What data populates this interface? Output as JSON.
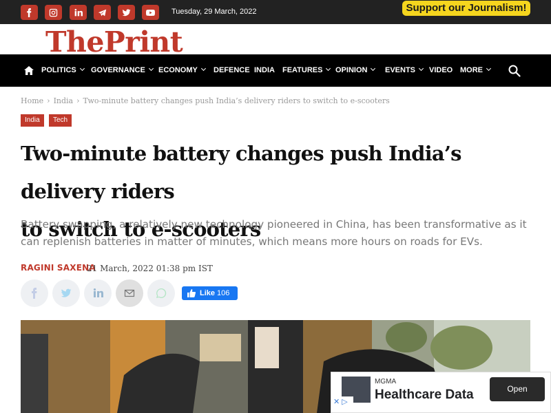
{
  "topbar": {
    "date": "Tuesday, 29 March, 2022",
    "support_label": "Support our Journalism!",
    "social_icons": [
      "facebook-icon",
      "instagram-icon",
      "linkedin-icon",
      "telegram-icon",
      "twitter-icon",
      "youtube-icon"
    ]
  },
  "logo": {
    "text": "ThePrint"
  },
  "nav": {
    "items": [
      {
        "label": "POLITICS",
        "dropdown": true
      },
      {
        "label": "GOVERNANCE",
        "dropdown": true
      },
      {
        "label": "ECONOMY",
        "dropdown": true
      },
      {
        "label": "DEFENCE",
        "dropdown": false
      },
      {
        "label": "INDIA",
        "dropdown": false
      },
      {
        "label": "FEATURES",
        "dropdown": true
      },
      {
        "label": "OPINION",
        "dropdown": true
      },
      {
        "label": "EVENTS",
        "dropdown": true
      },
      {
        "label": "VIDEO",
        "dropdown": false
      },
      {
        "label": "MORE",
        "dropdown": true
      }
    ]
  },
  "breadcrumb": {
    "home": "Home",
    "section": "India",
    "current": "Two-minute battery changes push India’s delivery riders to switch to e-scooters",
    "separator": "›"
  },
  "tags": [
    "India",
    "Tech"
  ],
  "article": {
    "headline_line1": "Two-minute battery changes push India’s delivery riders",
    "headline_line2": "to switch to e-scooters",
    "dek_line1": "Battery swapping, a relatively new technology pioneered in China, has been transformative as it",
    "dek_line2": "can replenish batteries in matter of minutes, which means more hours on roads for EVs.",
    "author": "RAGINI SAXENA",
    "published": "21 March, 2022 01:38 pm IST"
  },
  "share": {
    "icons": [
      "facebook-icon",
      "twitter-icon",
      "linkedin-icon",
      "email-icon",
      "whatsapp-icon"
    ],
    "like_label": "Like",
    "like_count": "106"
  },
  "ad": {
    "brand": "MGMA",
    "title": "Healthcare Data",
    "button": "Open"
  },
  "colors": {
    "brand_red": "#c0392b",
    "topbar": "#222222",
    "navbar": "#000000",
    "support_yellow": "#f5d51e",
    "facebook_blue": "#1877f2"
  }
}
